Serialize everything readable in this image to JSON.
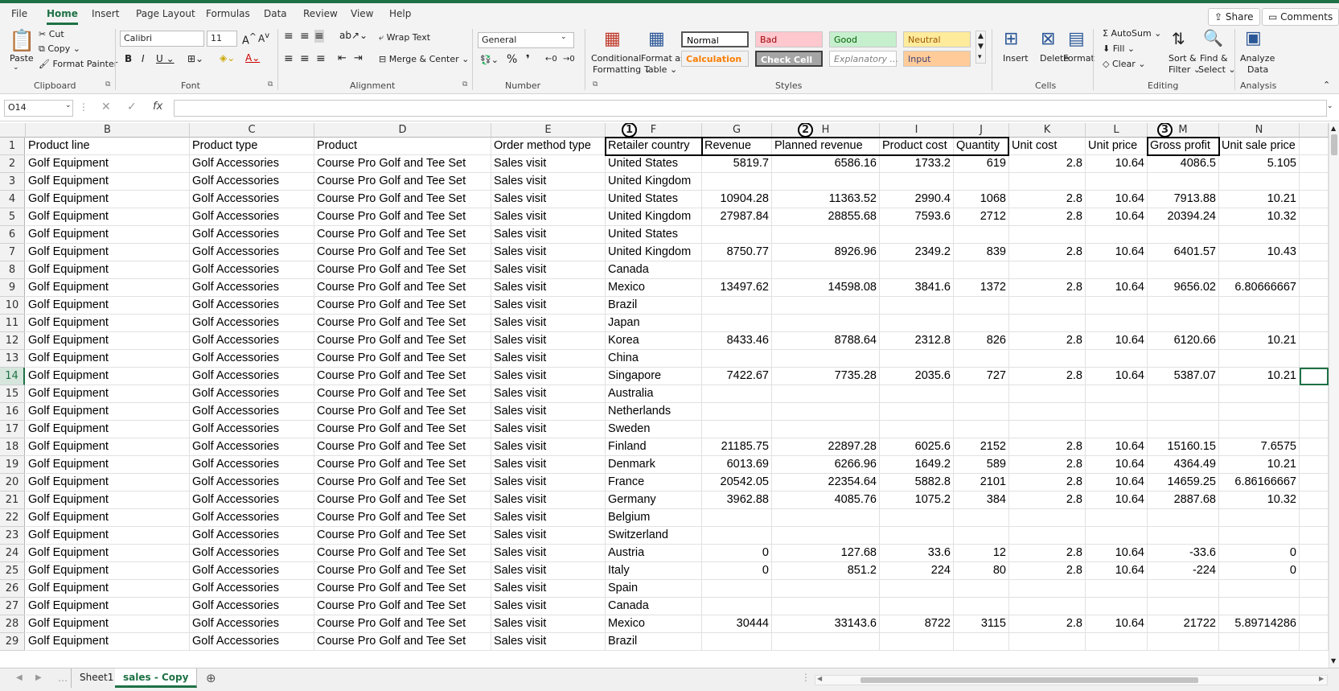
{
  "menu": [
    "File",
    "Home",
    "Insert",
    "Page Layout",
    "Formulas",
    "Data",
    "Review",
    "View",
    "Help"
  ],
  "share_label": "Share",
  "comments_label": "Comments",
  "clipboard": {
    "paste": "Paste",
    "cut": "Cut",
    "copy": "Copy",
    "format_painter": "Format Painter",
    "group": "Clipboard"
  },
  "font": {
    "name": "Calibri",
    "size": "11",
    "group": "Font"
  },
  "alignment": {
    "wrap": "Wrap Text",
    "merge": "Merge & Center",
    "group": "Alignment"
  },
  "number": {
    "format": "General",
    "group": "Number"
  },
  "styles": {
    "cond1": "Conditional",
    "cond2": "Formatting",
    "fmt1": "Format as",
    "fmt2": "Table",
    "cells": [
      {
        "label": "Normal",
        "bg": "#ffffff",
        "fg": "#000000"
      },
      {
        "label": "Bad",
        "bg": "#ffc7ce",
        "fg": "#9c0006"
      },
      {
        "label": "Good",
        "bg": "#c6efce",
        "fg": "#006100"
      },
      {
        "label": "Neutral",
        "bg": "#ffeb9c",
        "fg": "#9c5700"
      },
      {
        "label": "Calculation",
        "bg": "#f2f2f2",
        "fg": "#fa7d00"
      },
      {
        "label": "Check Cell",
        "bg": "#a5a5a5",
        "fg": "#ffffff"
      },
      {
        "label": "Explanatory ...",
        "bg": "#ffffff",
        "fg": "#7f7f7f"
      },
      {
        "label": "Input",
        "bg": "#ffcc99",
        "fg": "#3f3f76"
      }
    ],
    "group": "Styles"
  },
  "cells_group": {
    "insert": "Insert",
    "delete": "Delete",
    "format": "Format",
    "group": "Cells"
  },
  "editing": {
    "autosum": "AutoSum",
    "fill": "Fill",
    "clear": "Clear",
    "sort1": "Sort &",
    "sort2": "Filter",
    "find1": "Find &",
    "find2": "Select",
    "group": "Editing"
  },
  "analysis": {
    "btn1": "Analyze",
    "btn2": "Data",
    "group": "Analysis"
  },
  "namebox": "O14",
  "columns": [
    "B",
    "C",
    "D",
    "E",
    "F",
    "G",
    "H",
    "I",
    "J",
    "K",
    "L",
    "M",
    "N"
  ],
  "annotations": [
    "1",
    "2",
    "3"
  ],
  "rows": [
    [
      "1",
      "Product line",
      "Product type",
      "Product",
      "Order method type",
      "Retailer country",
      "Revenue",
      "Planned revenue",
      "Product cost",
      "Quantity",
      "Unit cost",
      "Unit price",
      "Gross profit",
      "Unit sale price"
    ],
    [
      "2",
      "Golf Equipment",
      "Golf Accessories",
      "Course Pro Golf and Tee Set",
      "Sales visit",
      "United States",
      "5819.7",
      "6586.16",
      "1733.2",
      "619",
      "2.8",
      "10.64",
      "4086.5",
      "5.105"
    ],
    [
      "3",
      "Golf Equipment",
      "Golf Accessories",
      "Course Pro Golf and Tee Set",
      "Sales visit",
      "United Kingdom",
      "",
      "",
      "",
      "",
      "",
      "",
      "",
      ""
    ],
    [
      "4",
      "Golf Equipment",
      "Golf Accessories",
      "Course Pro Golf and Tee Set",
      "Sales visit",
      "United States",
      "10904.28",
      "11363.52",
      "2990.4",
      "1068",
      "2.8",
      "10.64",
      "7913.88",
      "10.21"
    ],
    [
      "5",
      "Golf Equipment",
      "Golf Accessories",
      "Course Pro Golf and Tee Set",
      "Sales visit",
      "United Kingdom",
      "27987.84",
      "28855.68",
      "7593.6",
      "2712",
      "2.8",
      "10.64",
      "20394.24",
      "10.32"
    ],
    [
      "6",
      "Golf Equipment",
      "Golf Accessories",
      "Course Pro Golf and Tee Set",
      "Sales visit",
      "United States",
      "",
      "",
      "",
      "",
      "",
      "",
      "",
      ""
    ],
    [
      "7",
      "Golf Equipment",
      "Golf Accessories",
      "Course Pro Golf and Tee Set",
      "Sales visit",
      "United Kingdom",
      "8750.77",
      "8926.96",
      "2349.2",
      "839",
      "2.8",
      "10.64",
      "6401.57",
      "10.43"
    ],
    [
      "8",
      "Golf Equipment",
      "Golf Accessories",
      "Course Pro Golf and Tee Set",
      "Sales visit",
      "Canada",
      "",
      "",
      "",
      "",
      "",
      "",
      "",
      ""
    ],
    [
      "9",
      "Golf Equipment",
      "Golf Accessories",
      "Course Pro Golf and Tee Set",
      "Sales visit",
      "Mexico",
      "13497.62",
      "14598.08",
      "3841.6",
      "1372",
      "2.8",
      "10.64",
      "9656.02",
      "6.80666667"
    ],
    [
      "10",
      "Golf Equipment",
      "Golf Accessories",
      "Course Pro Golf and Tee Set",
      "Sales visit",
      "Brazil",
      "",
      "",
      "",
      "",
      "",
      "",
      "",
      ""
    ],
    [
      "11",
      "Golf Equipment",
      "Golf Accessories",
      "Course Pro Golf and Tee Set",
      "Sales visit",
      "Japan",
      "",
      "",
      "",
      "",
      "",
      "",
      "",
      ""
    ],
    [
      "12",
      "Golf Equipment",
      "Golf Accessories",
      "Course Pro Golf and Tee Set",
      "Sales visit",
      "Korea",
      "8433.46",
      "8788.64",
      "2312.8",
      "826",
      "2.8",
      "10.64",
      "6120.66",
      "10.21"
    ],
    [
      "13",
      "Golf Equipment",
      "Golf Accessories",
      "Course Pro Golf and Tee Set",
      "Sales visit",
      "China",
      "",
      "",
      "",
      "",
      "",
      "",
      "",
      ""
    ],
    [
      "14",
      "Golf Equipment",
      "Golf Accessories",
      "Course Pro Golf and Tee Set",
      "Sales visit",
      "Singapore",
      "7422.67",
      "7735.28",
      "2035.6",
      "727",
      "2.8",
      "10.64",
      "5387.07",
      "10.21"
    ],
    [
      "15",
      "Golf Equipment",
      "Golf Accessories",
      "Course Pro Golf and Tee Set",
      "Sales visit",
      "Australia",
      "",
      "",
      "",
      "",
      "",
      "",
      "",
      ""
    ],
    [
      "16",
      "Golf Equipment",
      "Golf Accessories",
      "Course Pro Golf and Tee Set",
      "Sales visit",
      "Netherlands",
      "",
      "",
      "",
      "",
      "",
      "",
      "",
      ""
    ],
    [
      "17",
      "Golf Equipment",
      "Golf Accessories",
      "Course Pro Golf and Tee Set",
      "Sales visit",
      "Sweden",
      "",
      "",
      "",
      "",
      "",
      "",
      "",
      ""
    ],
    [
      "18",
      "Golf Equipment",
      "Golf Accessories",
      "Course Pro Golf and Tee Set",
      "Sales visit",
      "Finland",
      "21185.75",
      "22897.28",
      "6025.6",
      "2152",
      "2.8",
      "10.64",
      "15160.15",
      "7.6575"
    ],
    [
      "19",
      "Golf Equipment",
      "Golf Accessories",
      "Course Pro Golf and Tee Set",
      "Sales visit",
      "Denmark",
      "6013.69",
      "6266.96",
      "1649.2",
      "589",
      "2.8",
      "10.64",
      "4364.49",
      "10.21"
    ],
    [
      "20",
      "Golf Equipment",
      "Golf Accessories",
      "Course Pro Golf and Tee Set",
      "Sales visit",
      "France",
      "20542.05",
      "22354.64",
      "5882.8",
      "2101",
      "2.8",
      "10.64",
      "14659.25",
      "6.86166667"
    ],
    [
      "21",
      "Golf Equipment",
      "Golf Accessories",
      "Course Pro Golf and Tee Set",
      "Sales visit",
      "Germany",
      "3962.88",
      "4085.76",
      "1075.2",
      "384",
      "2.8",
      "10.64",
      "2887.68",
      "10.32"
    ],
    [
      "22",
      "Golf Equipment",
      "Golf Accessories",
      "Course Pro Golf and Tee Set",
      "Sales visit",
      "Belgium",
      "",
      "",
      "",
      "",
      "",
      "",
      "",
      ""
    ],
    [
      "23",
      "Golf Equipment",
      "Golf Accessories",
      "Course Pro Golf and Tee Set",
      "Sales visit",
      "Switzerland",
      "",
      "",
      "",
      "",
      "",
      "",
      "",
      ""
    ],
    [
      "24",
      "Golf Equipment",
      "Golf Accessories",
      "Course Pro Golf and Tee Set",
      "Sales visit",
      "Austria",
      "0",
      "127.68",
      "33.6",
      "12",
      "2.8",
      "10.64",
      "-33.6",
      "0"
    ],
    [
      "25",
      "Golf Equipment",
      "Golf Accessories",
      "Course Pro Golf and Tee Set",
      "Sales visit",
      "Italy",
      "0",
      "851.2",
      "224",
      "80",
      "2.8",
      "10.64",
      "-224",
      "0"
    ],
    [
      "26",
      "Golf Equipment",
      "Golf Accessories",
      "Course Pro Golf and Tee Set",
      "Sales visit",
      "Spain",
      "",
      "",
      "",
      "",
      "",
      "",
      "",
      ""
    ],
    [
      "27",
      "Golf Equipment",
      "Golf Accessories",
      "Course Pro Golf and Tee Set",
      "Sales visit",
      "Canada",
      "",
      "",
      "",
      "",
      "",
      "",
      "",
      ""
    ],
    [
      "28",
      "Golf Equipment",
      "Golf Accessories",
      "Course Pro Golf and Tee Set",
      "Sales visit",
      "Mexico",
      "30444",
      "33143.6",
      "8722",
      "3115",
      "2.8",
      "10.64",
      "21722",
      "5.89714286"
    ],
    [
      "29",
      "Golf Equipment",
      "Golf Accessories",
      "Course Pro Golf and Tee Set",
      "Sales visit",
      "Brazil",
      "",
      "",
      "",
      "",
      "",
      "",
      "",
      ""
    ]
  ],
  "sheets": [
    "Sheet1",
    "sales - Copy"
  ],
  "active_sheet": "sales - Copy",
  "accent": "#1e7145"
}
